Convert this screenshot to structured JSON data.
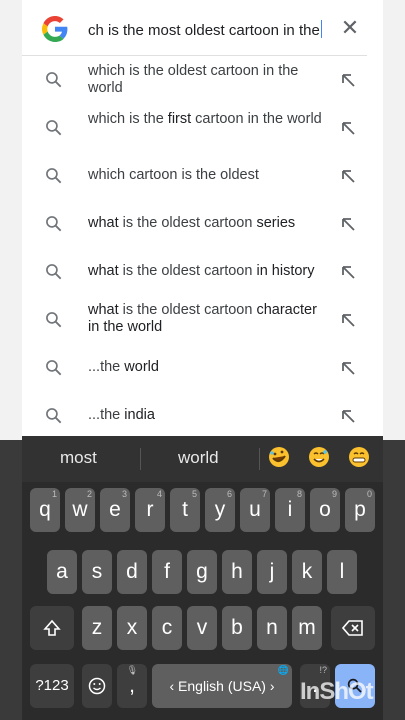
{
  "search": {
    "query": "ch is the most oldest cartoon in the"
  },
  "suggestions": [
    {
      "pre": "which is the oldest cartoon in the world",
      "bold": "",
      "post": ""
    },
    {
      "pre": "which is the ",
      "bold": "first",
      "post": " cartoon in the world"
    },
    {
      "pre": "which cartoon is the oldest",
      "bold": "",
      "post": ""
    },
    {
      "pre": "",
      "bold": "what",
      "post": " is the oldest cartoon ",
      "bold2": "series"
    },
    {
      "pre": "",
      "bold": "what",
      "post": " is the oldest cartoon ",
      "bold2": "in history"
    },
    {
      "pre": "",
      "bold": "what",
      "post": " is the oldest cartoon ",
      "bold2": "character in the world"
    },
    {
      "pre": "...the ",
      "bold": "world",
      "post": ""
    },
    {
      "pre": "...the ",
      "bold": "india",
      "post": ""
    }
  ],
  "keyboard": {
    "predictions": [
      "most",
      "world"
    ],
    "emojis": [
      "rofl-emoji",
      "sweat-smile-emoji",
      "grin-emoji"
    ],
    "row1": [
      "q",
      "w",
      "e",
      "r",
      "t",
      "y",
      "u",
      "i",
      "o",
      "p"
    ],
    "row1_nums": [
      "1",
      "2",
      "3",
      "4",
      "5",
      "6",
      "7",
      "8",
      "9",
      "0"
    ],
    "row2": [
      "a",
      "s",
      "d",
      "f",
      "g",
      "h",
      "j",
      "k",
      "l"
    ],
    "row3": [
      "z",
      "x",
      "c",
      "v",
      "b",
      "n",
      "m"
    ],
    "sym_label": "?123",
    "comma": ",",
    "space_label": "English (USA)",
    "period": "."
  },
  "watermark": "InShOt"
}
